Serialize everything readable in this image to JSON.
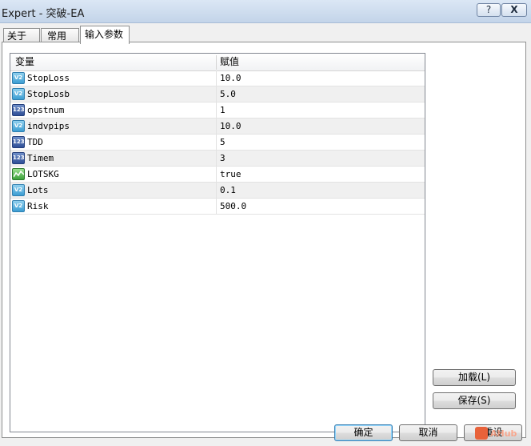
{
  "window": {
    "title": "Expert - 突破-EA",
    "help_label": "?",
    "close_label": "X"
  },
  "tabs": [
    {
      "label": "关于"
    },
    {
      "label": "常用"
    },
    {
      "label": "输入参数",
      "active": true
    }
  ],
  "grid": {
    "header_variable": "变量",
    "header_value": "赋值",
    "rows": [
      {
        "icon": "double-type-icon",
        "icon_text": "V2",
        "name": "StopLoss",
        "value": "10.0"
      },
      {
        "icon": "double-type-icon",
        "icon_text": "V2",
        "name": "StopLosb",
        "value": "5.0"
      },
      {
        "icon": "integer-type-icon",
        "icon_text": "123",
        "name": "opstnum",
        "value": "1"
      },
      {
        "icon": "double-type-icon",
        "icon_text": "V2",
        "name": "indvpips",
        "value": "10.0"
      },
      {
        "icon": "integer-type-icon",
        "icon_text": "123",
        "name": "TDD",
        "value": "5"
      },
      {
        "icon": "integer-type-icon",
        "icon_text": "123",
        "name": "Timem",
        "value": "3"
      },
      {
        "icon": "boolean-type-icon",
        "icon_text": "",
        "name": "LOTSKG",
        "value": "true"
      },
      {
        "icon": "double-type-icon",
        "icon_text": "V2",
        "name": "Lots",
        "value": "0.1"
      },
      {
        "icon": "double-type-icon",
        "icon_text": "V2",
        "name": "Risk",
        "value": "500.0"
      }
    ]
  },
  "side_buttons": {
    "load": "加载(L)",
    "save": "保存(S)"
  },
  "footer_buttons": {
    "ok": "确定",
    "cancel": "取消",
    "reset": "重设"
  },
  "watermark": {
    "text": "AHub"
  },
  "colors": {
    "title_bar": "#c3d4e9",
    "alt_row": "#f0f0f0",
    "default_button_border": "#3c7fb1"
  }
}
